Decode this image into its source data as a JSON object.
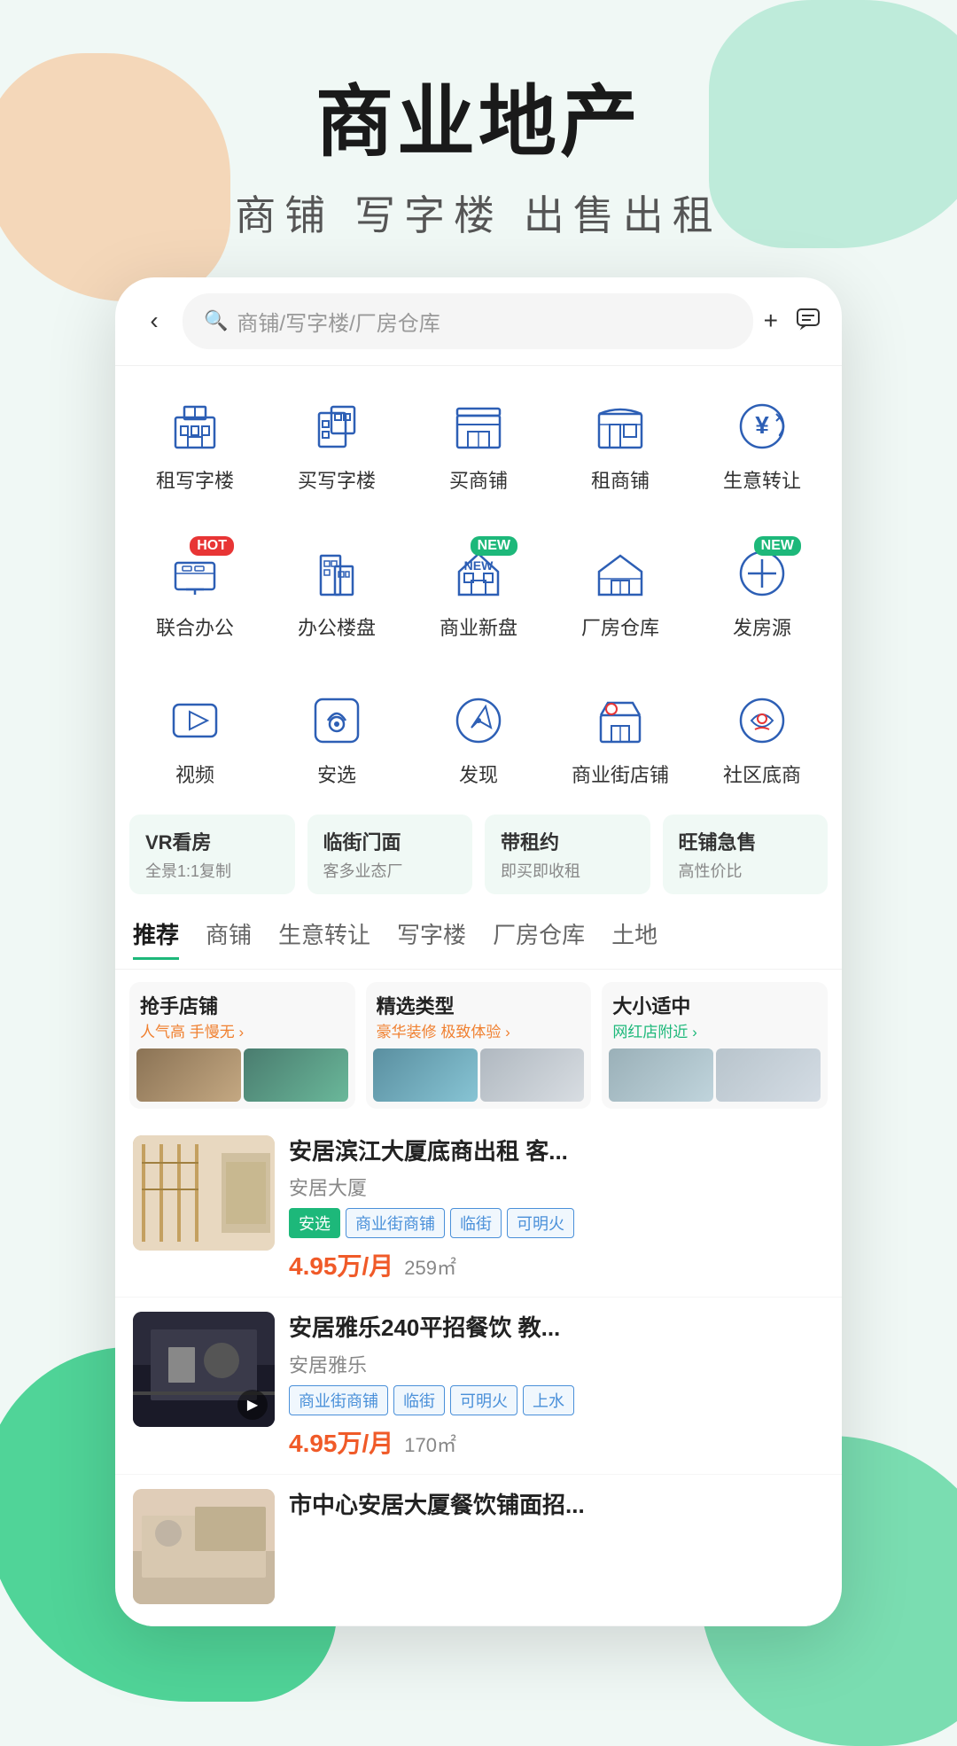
{
  "page": {
    "background": {
      "blob_peach_color": "#f5c9a0",
      "blob_green_top_color": "#a8e6cf",
      "blob_green_bottom_color": "#3ecf8e"
    },
    "header": {
      "main_title": "商业地产",
      "sub_title": "商铺  写字楼  出售出租"
    },
    "phone": {
      "topbar": {
        "back_label": "‹",
        "search_placeholder": "商铺/写字楼/厂房仓库",
        "add_icon": "+",
        "chat_icon": "□"
      },
      "categories_row1": [
        {
          "id": "rent-office",
          "icon": "🏢",
          "label": "租写字楼",
          "badge": null
        },
        {
          "id": "buy-office",
          "icon": "🏗",
          "label": "买写字楼",
          "badge": null
        },
        {
          "id": "buy-shop",
          "icon": "🏛",
          "label": "买商铺",
          "badge": null
        },
        {
          "id": "rent-shop",
          "icon": "🏪",
          "label": "租商铺",
          "badge": null
        },
        {
          "id": "transfer-biz",
          "icon": "💱",
          "label": "生意转让",
          "badge": null
        }
      ],
      "categories_row2": [
        {
          "id": "cowork",
          "icon": "🖥",
          "label": "联合办公",
          "badge": "HOT"
        },
        {
          "id": "office-building",
          "icon": "🏙",
          "label": "办公楼盘",
          "badge": null
        },
        {
          "id": "commercial-new",
          "icon": "🏠",
          "label": "商业新盘",
          "badge": "NEW"
        },
        {
          "id": "warehouse",
          "icon": "🏠",
          "label": "厂房仓库",
          "badge": null
        },
        {
          "id": "post-source",
          "icon": "➕",
          "label": "发房源",
          "badge": "NEW"
        }
      ],
      "categories_row3": [
        {
          "id": "video",
          "icon": "▶",
          "label": "视频",
          "badge": null
        },
        {
          "id": "anxuan",
          "icon": "🏅",
          "label": "安选",
          "badge": null
        },
        {
          "id": "discover",
          "icon": "🧭",
          "label": "发现",
          "badge": null
        },
        {
          "id": "street-shops",
          "icon": "🛍",
          "label": "商业街店铺",
          "badge": null
        },
        {
          "id": "community-shop",
          "icon": "❤",
          "label": "社区底商",
          "badge": null
        }
      ],
      "feature_tags": [
        {
          "id": "vr",
          "title": "VR看房",
          "sub": "全景1:1复制"
        },
        {
          "id": "street-front",
          "title": "临街门面",
          "sub": "客多业态厂"
        },
        {
          "id": "with-rent",
          "title": "带租约",
          "sub": "即买即收租"
        },
        {
          "id": "urgent-sell",
          "title": "旺铺急售",
          "sub": "高性价比"
        }
      ],
      "tabs": [
        {
          "id": "recommend",
          "label": "推荐",
          "active": true
        },
        {
          "id": "shops",
          "label": "商铺",
          "active": false
        },
        {
          "id": "transfer",
          "label": "生意转让",
          "active": false
        },
        {
          "id": "office",
          "label": "写字楼",
          "active": false
        },
        {
          "id": "warehouse",
          "label": "厂房仓库",
          "active": false
        },
        {
          "id": "land",
          "label": "土地",
          "active": false
        }
      ],
      "promo_cards": [
        {
          "id": "grab-shop",
          "title": "抢手店铺",
          "sub": "人气高 手慢无 ›",
          "imgs": [
            "promo-img-1",
            "promo-img-2"
          ]
        },
        {
          "id": "selected-type",
          "title": "精选类型",
          "sub": "豪华装修 极致体验 ›",
          "imgs": [
            "promo-img-3",
            "promo-img-4"
          ]
        },
        {
          "id": "right-size",
          "title": "大小适中",
          "sub": "网红店附近 ›",
          "imgs": [
            "promo-img-5",
            "promo-img-6"
          ]
        }
      ],
      "listings": [
        {
          "id": "listing-1",
          "title": "安居滨江大厦底商出租 客...",
          "building": "安居大厦",
          "tags": [
            "安选",
            "商业街商铺",
            "临街",
            "可明火"
          ],
          "tag_types": [
            "selected",
            "blue",
            "blue",
            "blue"
          ],
          "price": "4.95万/月",
          "area": "259㎡",
          "thumb_class": "thumb-1",
          "has_play": false
        },
        {
          "id": "listing-2",
          "title": "安居雅乐240平招餐饮 教...",
          "building": "安居雅乐",
          "tags": [
            "商业街商铺",
            "临街",
            "可明火",
            "上水"
          ],
          "tag_types": [
            "blue",
            "blue",
            "blue",
            "blue"
          ],
          "price": "4.95万/月",
          "area": "170㎡",
          "thumb_class": "thumb-2",
          "has_play": true
        },
        {
          "id": "listing-3",
          "title": "市中心安居大厦餐饮铺面招...",
          "building": "",
          "tags": [],
          "tag_types": [],
          "price": "",
          "area": "",
          "thumb_class": "thumb-3",
          "has_play": false
        }
      ]
    }
  }
}
